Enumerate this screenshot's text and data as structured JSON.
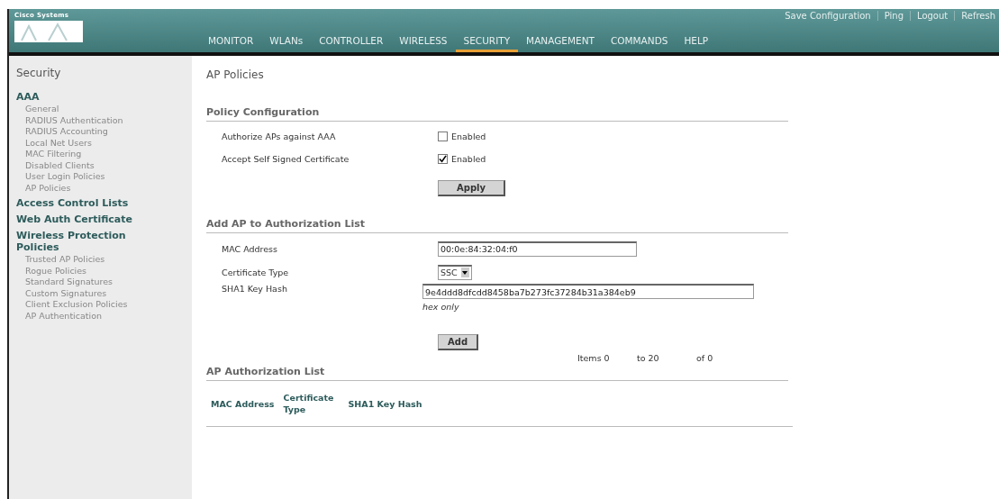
{
  "header": {
    "logo_text": "Cisco Systems",
    "top_links": [
      "Save Configuration",
      "Ping",
      "Logout",
      "Refresh"
    ],
    "nav": [
      {
        "label": "MONITOR",
        "selected": false
      },
      {
        "label": "WLANs",
        "selected": false
      },
      {
        "label": "CONTROLLER",
        "selected": false
      },
      {
        "label": "WIRELESS",
        "selected": false
      },
      {
        "label": "SECURITY",
        "selected": true
      },
      {
        "label": "MANAGEMENT",
        "selected": false
      },
      {
        "label": "COMMANDS",
        "selected": false
      },
      {
        "label": "HELP",
        "selected": false
      }
    ]
  },
  "sidebar": {
    "title": "Security",
    "sections": [
      {
        "label": "AAA",
        "children": [
          "General",
          "RADIUS Authentication",
          "RADIUS Accounting",
          "Local Net Users",
          "MAC Filtering",
          "Disabled Clients",
          "User Login Policies",
          "AP Policies"
        ]
      },
      {
        "label": "Access Control Lists"
      },
      {
        "label": "Web Auth Certificate"
      },
      {
        "label": "Wireless Protection Policies",
        "children": [
          "Trusted AP Policies",
          "Rogue Policies",
          "Standard Signatures",
          "Custom Signatures",
          "Client Exclusion Policies",
          "AP Authentication"
        ]
      }
    ]
  },
  "main": {
    "title": "AP Policies",
    "policy_configuration": {
      "heading": "Policy Configuration",
      "rows": [
        {
          "label": "Authorize APs against AAA",
          "checked": false,
          "option": "Enabled"
        },
        {
          "label": "Accept Self Signed Certificate",
          "checked": true,
          "option": "Enabled"
        }
      ],
      "button": "Apply"
    },
    "add_ap": {
      "heading": "Add AP to Authorization List",
      "mac": {
        "label": "MAC Address",
        "value": "00:0e:84:32:04:f0"
      },
      "certificate_type": {
        "label": "Certificate Type",
        "value": "SSC"
      },
      "sha1": {
        "label": "SHA1 Key Hash",
        "value": "9e4ddd8dfcdd8458ba7b273fc37284b31a384eb9",
        "hint": "hex only"
      },
      "button": "Add"
    },
    "authorization_list": {
      "heading": "AP Authorization List",
      "pager": [
        "Items 0",
        "to 20",
        "of 0"
      ],
      "columns": [
        "MAC Address",
        "Certificate Type",
        "SHA1 Key Hash"
      ]
    }
  }
}
